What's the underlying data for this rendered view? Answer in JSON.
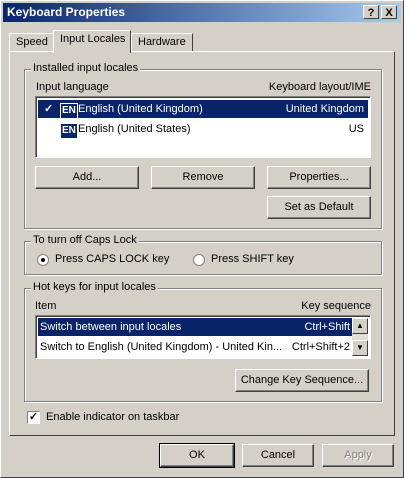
{
  "window": {
    "title": "Keyboard Properties",
    "help_button": "?",
    "close_button": "X"
  },
  "tabs": [
    {
      "label": "Speed"
    },
    {
      "label": "Input Locales"
    },
    {
      "label": "Hardware"
    }
  ],
  "installed": {
    "group_label": "Installed input locales",
    "col_language": "Input language",
    "col_layout": "Keyboard layout/IME",
    "items": [
      {
        "checkmark": "✓",
        "badge": "EN",
        "language": "English (United Kingdom)",
        "layout": "United Kingdom",
        "selected": true
      },
      {
        "checkmark": "",
        "badge": "EN",
        "language": "English (United States)",
        "layout": "US",
        "selected": false
      }
    ],
    "add_label": "Add...",
    "remove_label": "Remove",
    "properties_label": "Properties...",
    "set_default_label": "Set as Default"
  },
  "capslock": {
    "group_label": "To turn off Caps Lock",
    "option_caps": "Press CAPS LOCK key",
    "option_shift": "Press SHIFT key",
    "selected": "caps"
  },
  "hotkeys": {
    "group_label": "Hot keys for input locales",
    "col_item": "Item",
    "col_sequence": "Key sequence",
    "items": [
      {
        "item": "Switch between input locales",
        "sequence": "Ctrl+Shift",
        "selected": true
      },
      {
        "item": "Switch to English (United Kingdom) - United Kin...",
        "sequence": "Ctrl+Shift+2",
        "selected": false
      }
    ],
    "change_label": "Change Key Sequence..."
  },
  "taskbar": {
    "label": "Enable indicator on taskbar",
    "checked": true,
    "check_glyph": "✓"
  },
  "footer": {
    "ok_label": "OK",
    "cancel_label": "Cancel",
    "apply_label": "Apply"
  }
}
